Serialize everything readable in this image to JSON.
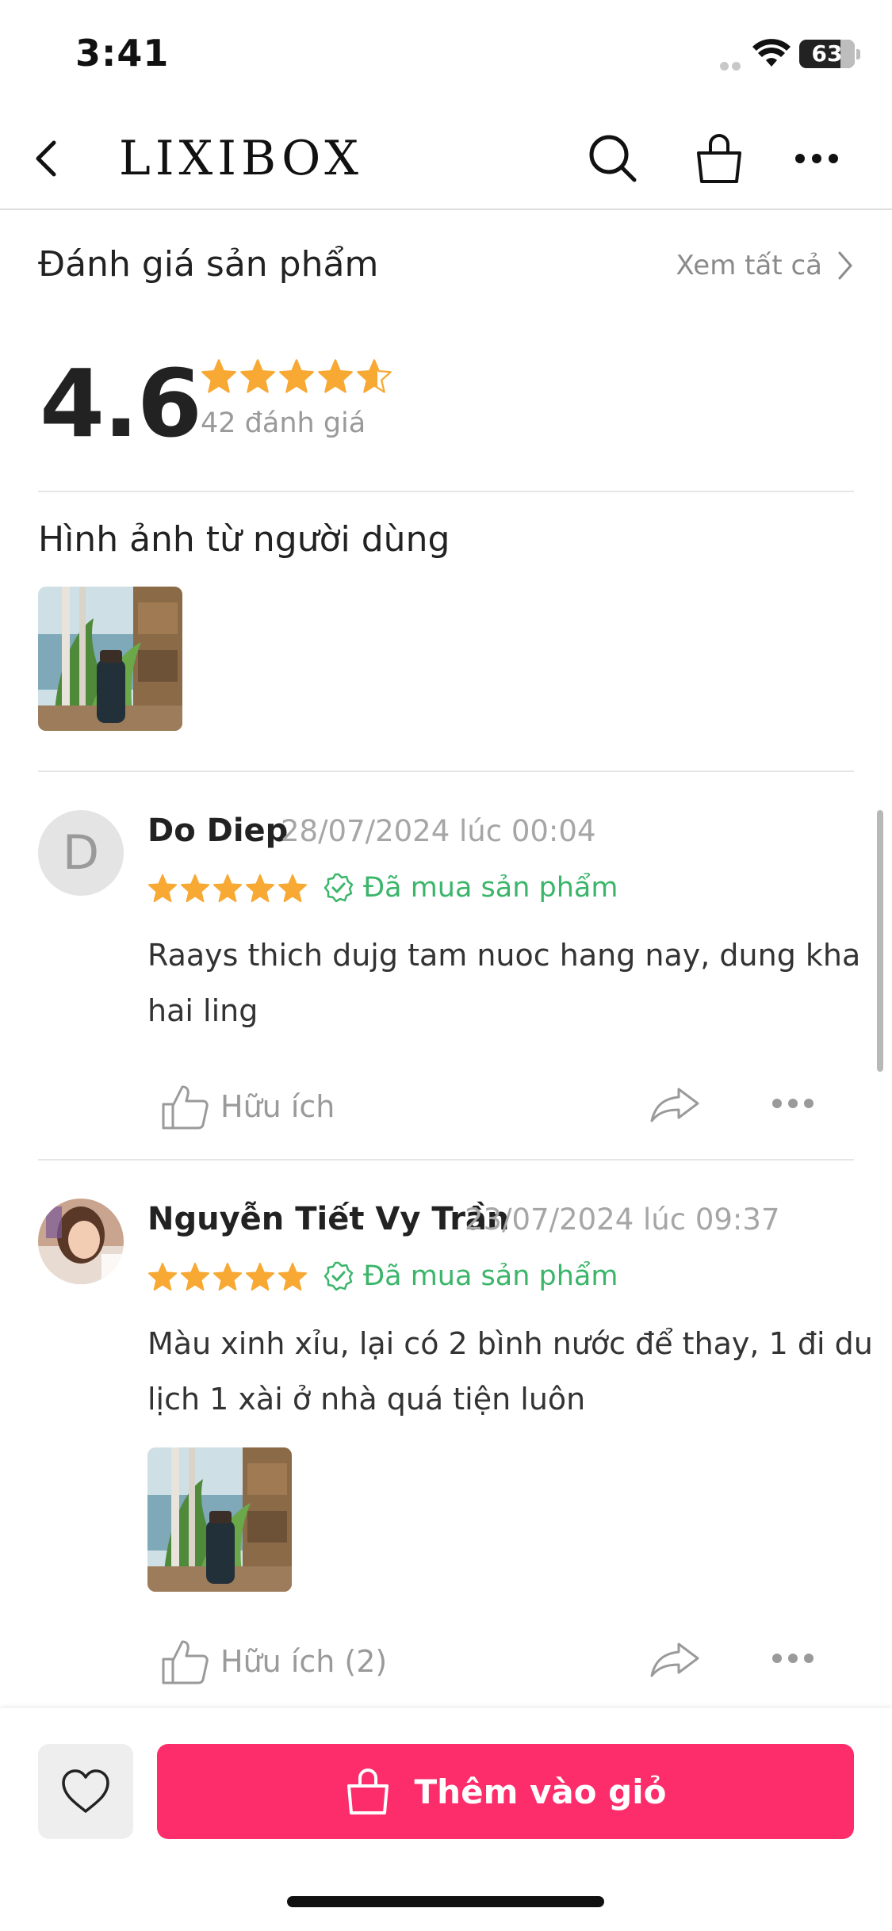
{
  "status_bar": {
    "time": "3:41",
    "battery": "63"
  },
  "nav": {
    "brand": "LIXIBOX",
    "icons": [
      "back-arrow-icon",
      "search-icon",
      "shopping-bag-icon",
      "more-icon"
    ]
  },
  "ratings": {
    "title": "Đánh giá sản phẩm",
    "view_all": "Xem tất cả",
    "score": "4.6",
    "count_text": "42 đánh giá",
    "stars": 4.6,
    "star_color": "#f7a934"
  },
  "user_photos": {
    "title": "Hình ảnh từ người dùng"
  },
  "reviews": [
    {
      "avatar_letter": "D",
      "name": "Do Diep",
      "date": "28/07/2024 lúc 00:04",
      "stars": 5,
      "verified": "Đã mua sản phẩm",
      "text": "Raays thich dujg tam nuoc hang nay, dung kha hai ling",
      "helpful": "Hữu ích"
    },
    {
      "name": "Nguyễn Tiết Vy Trần",
      "date": "23/07/2024 lúc 09:37",
      "stars": 5,
      "verified": "Đã mua sản phẩm",
      "text": "Màu xinh xỉu, lại có 2 bình nước để thay, 1 đi du lịch 1 xài ở nhà quá tiện luôn",
      "helpful": "Hữu ích (2)"
    }
  ],
  "bottom": {
    "add_to_cart": "Thêm vào giỏ",
    "accent": "#fd2d6b"
  }
}
